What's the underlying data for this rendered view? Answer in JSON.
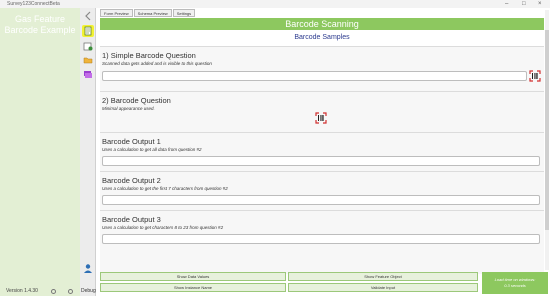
{
  "window": {
    "title": "Survey123ConnectBeta",
    "controls": [
      "–",
      "□",
      "×"
    ]
  },
  "left_panel": {
    "survey_title": "Gas Feature Barcode Example",
    "version": "Version 1.4.30",
    "accent": "#e3efd4"
  },
  "toolbar": {
    "icons": [
      "back-arrow-icon",
      "form-icon",
      "scan-icon",
      "folder-icon",
      "stack-icon",
      "avatar-icon"
    ],
    "debug_label": "Debug"
  },
  "tabs": [
    "Form Preview",
    "Schema Preview",
    "Settings"
  ],
  "header": {
    "title": "Barcode Scanning",
    "subtitle": "Barcode Samples",
    "color": "#8dc85f"
  },
  "questions": [
    {
      "title": "1) Simple Barcode Question",
      "hint": "Scanned data gets added and is visible to this question",
      "value": ""
    },
    {
      "title": "2) Barcode Question",
      "hint": "Minimal appearance used."
    },
    {
      "title": "Barcode Output 1",
      "hint": "Uses a calculation to get all data from question #2",
      "value": ""
    },
    {
      "title": "Barcode Output 2",
      "hint": "Uses a calculation to get the first 7 characters from question #2",
      "value": ""
    },
    {
      "title": "Barcode Output 3",
      "hint": "Uses a calculation to get characters 8 to 23 from question #2",
      "value": ""
    }
  ],
  "buttons": {
    "show_data_values": "Show Data Values",
    "show_feature_object": "Show Feature Object",
    "show_instance_name": "Show Instance Name",
    "validate_input": "Validate Input"
  },
  "load_time": {
    "line1": "Load time on windows:",
    "line2": "0.3 seconds"
  }
}
